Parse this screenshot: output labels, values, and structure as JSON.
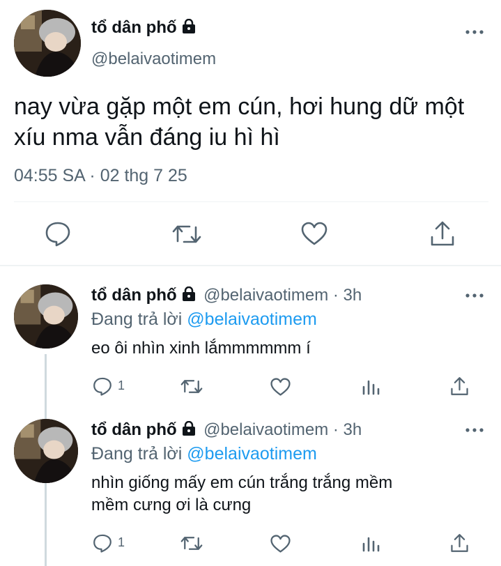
{
  "main_tweet": {
    "display_name": "tổ dân phố",
    "handle": "@belaivaotimem",
    "text_line1": "nay vừa gặp một em cún, hơi hung dữ một",
    "text_line2": "xíu nma vẫn đáng iu hì hì",
    "timestamp": "04:55 SA · 02 thg 7 25",
    "actions": [
      "reply-icon",
      "retweet-icon",
      "like-icon",
      "share-icon"
    ]
  },
  "replies": [
    {
      "display_name": "tổ dân phố",
      "handle_time": "@belaivaotimem · 3h",
      "replying_prefix": "Đang trả lời",
      "replying_to": "@belaivaotimem",
      "text_line1": "eo ôi nhìn xinh lắmmmmmm í",
      "text_line2": "",
      "reply_count": "1"
    },
    {
      "display_name": "tổ dân phố",
      "handle_time": "@belaivaotimem · 3h",
      "replying_prefix": "Đang trả lời",
      "replying_to": "@belaivaotimem",
      "text_line1": "nhìn giống mấy em cún trắng trắng mềm",
      "text_line2": "mềm cưng ơi là cưng",
      "reply_count": "1"
    }
  ],
  "colors": {
    "text": "#0f1419",
    "secondary": "#536471",
    "link": "#1d9bf0",
    "divider": "#eff3f4"
  }
}
